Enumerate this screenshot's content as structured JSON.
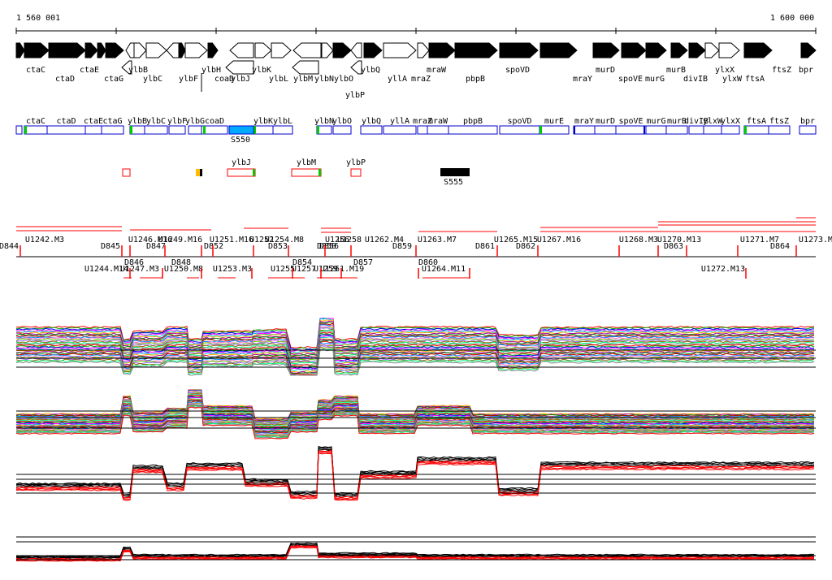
{
  "ruler": {
    "start_label": "1 560 001",
    "end_label": "1 600 000"
  },
  "colors": {
    "gene_fill": "#000000",
    "feature_stroke": "#0000cc",
    "feature_accent": "#00cc00",
    "highlight": "#00aaff",
    "tu_stroke": "#ff0000",
    "yellow_marker": "#ffbb00",
    "profile_control": "#000000",
    "profile_condition": "#ff0000"
  },
  "genes_forward_top": [
    "ctaC",
    "ctaE",
    "ylbB",
    "ylbH",
    "ylbK",
    "ylbQ",
    "mraW",
    "spoVD",
    "murD",
    "murB",
    "ylxX",
    "ftsZ",
    "bpr"
  ],
  "genes_forward_bottom": [
    "ctaD",
    "ctaG",
    "ylbC",
    "coaD",
    "ylbL",
    "ylbN",
    "ylbO",
    "yllA",
    "mraZ",
    "pbpB",
    "mraY",
    "spoVE",
    "murG",
    "divIB",
    "ylxW",
    "ftsA"
  ],
  "genes_reverse": [
    "ylbF",
    "ylbJ",
    "ylbM",
    "ylbP"
  ],
  "features_row": [
    "ctaC",
    "ctaD",
    "ctaE",
    "ctaG",
    "ylbB",
    "ylbC",
    "ylbF",
    "ylbG",
    "coaD",
    "ylbK",
    "ylbL",
    "ylbN",
    "ylbO",
    "ylbQ",
    "yllA",
    "mraZ",
    "mraW",
    "pbpB",
    "spoVD",
    "murE",
    "mraY",
    "murD",
    "spoVE",
    "murG",
    "murB",
    "divIB",
    "ylxW",
    "ylxX",
    "ftsA",
    "ftsZ",
    "bpr"
  ],
  "highlight_label": "S550",
  "lower_labels": [
    "ylbJ",
    "ylbM",
    "ylbP"
  ],
  "black_box_label": "S555",
  "segments_top": [
    "U1242.M3",
    "D845",
    "U1246.M16",
    "D847",
    "U1249.M16",
    "U1251.M16",
    "U1252",
    "U1254.M8",
    "D850",
    "U1256",
    "U1258",
    "U1262.M4",
    "D859",
    "U1263.M7",
    "D861",
    "U1265.M15",
    "U1267.M16",
    "U1268.M3",
    "U1270.M13",
    "D863",
    "U1271.M7",
    "U1273.M",
    "D844"
  ],
  "segments_bottom": [
    "D846",
    "D848",
    "D852",
    "D853",
    "D854",
    "D856",
    "D857",
    "D862",
    "D860",
    "D864",
    "U1244.M14",
    "U1247.M3",
    "U1250.M8",
    "U1253.M3",
    "U1255",
    "U1257",
    "U1259",
    "U1261.M19",
    "U1264.M11",
    "U1272.M13"
  ]
}
